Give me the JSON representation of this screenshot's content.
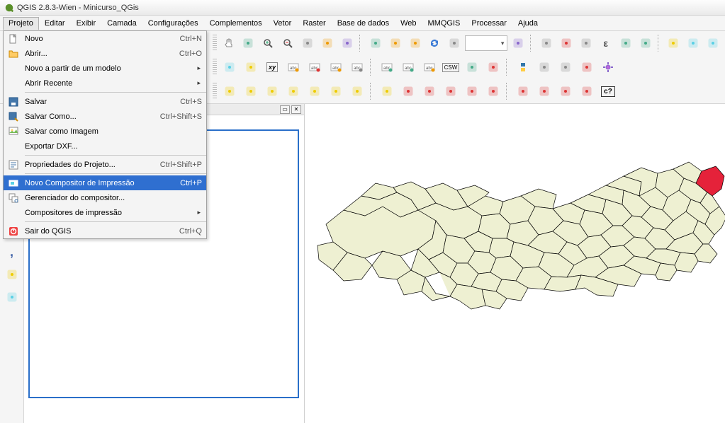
{
  "window": {
    "title": "QGIS 2.8.3-Wien - Minicurso_QGis"
  },
  "menubar": {
    "items": [
      "Projeto",
      "Editar",
      "Exibir",
      "Camada",
      "Configurações",
      "Complementos",
      "Vetor",
      "Raster",
      "Base de dados",
      "Web",
      "MMQGIS",
      "Processar",
      "Ajuda"
    ]
  },
  "dropdown": {
    "items": [
      {
        "icon": "new-file-icon",
        "label": "Novo",
        "shortcut": "Ctrl+N"
      },
      {
        "icon": "open-folder-icon",
        "label": "Abrir...",
        "shortcut": "Ctrl+O"
      },
      {
        "icon": "",
        "label": "Novo a partir de um modelo",
        "submenu": true
      },
      {
        "icon": "",
        "label": "Abrir Recente",
        "submenu": true
      },
      {
        "sep": true
      },
      {
        "icon": "save-icon",
        "label": "Salvar",
        "shortcut": "Ctrl+S"
      },
      {
        "icon": "save-as-icon",
        "label": "Salvar Como...",
        "shortcut": "Ctrl+Shift+S"
      },
      {
        "icon": "save-image-icon",
        "label": "Salvar como Imagem"
      },
      {
        "icon": "",
        "label": "Exportar DXF..."
      },
      {
        "sep": true
      },
      {
        "icon": "properties-icon",
        "label": "Propriedades do Projeto...",
        "shortcut": "Ctrl+Shift+P"
      },
      {
        "sep": true
      },
      {
        "icon": "print-composer-icon",
        "label": "Novo Compositor de Impressão",
        "shortcut": "Ctrl+P",
        "selected": true
      },
      {
        "icon": "composer-manager-icon",
        "label": "Gerenciador do compositor..."
      },
      {
        "icon": "",
        "label": "Compositores de impressão",
        "submenu": true
      },
      {
        "sep": true
      },
      {
        "icon": "exit-icon",
        "label": "Sair do QGIS",
        "shortcut": "Ctrl+Q"
      }
    ]
  },
  "toolbar": {
    "row1_icons": [
      "hand-icon",
      "pan-select-icon",
      "zoom-in-icon",
      "zoom-out-icon",
      "zoom-1-1-icon",
      "zoom-full-icon",
      "zoom-selection-icon",
      "zoom-layer-icon",
      "zoom-last-icon",
      "zoom-next-icon",
      "refresh-icon",
      "identify-icon",
      "select-icon",
      "deselect-icon",
      "measure-icon",
      "bookmark-icon",
      "epsilon-icon",
      "attr-table-icon",
      "field-calc-icon",
      "stats-icon",
      "tips-icon",
      "html-icon"
    ],
    "row2_icons": [
      "copy-icon",
      "paste-icon",
      "xy-icon",
      "abc-label-icon",
      "abc-pin-icon",
      "abc-layer-icon",
      "abc-move-icon",
      "abc-rotate-icon",
      "abc-change-icon",
      "abc-plain-icon",
      "csw-icon",
      "db-icon",
      "diamond-icon",
      "python-icon",
      "calendar-icon",
      "mountain-icon",
      "palette-icon",
      "gear-icon"
    ],
    "row3_icons": [
      "poly1-icon",
      "poly2-icon",
      "poly3-icon",
      "poly4-icon",
      "poly5-icon",
      "poly6-icon",
      "poly7-icon",
      "poly8-icon",
      "raster1-icon",
      "raster2-icon",
      "raster3-icon",
      "raster4-icon",
      "raster5-icon",
      "raster6-icon",
      "raster7-icon",
      "raster8-icon",
      "raster9-icon",
      "help-icon"
    ],
    "help_label": "c?"
  },
  "leftbar_icons": [
    "wave-icon",
    "dots-icon",
    "puzzle-icon",
    "globe-add-icon",
    "globe-grid-icon",
    "vector-node-icon",
    "comma-icon",
    "nodes-icon",
    "tree-icon"
  ],
  "colors": {
    "accent": "#2f6fd0",
    "map_fill": "#eef0d2",
    "map_stroke": "#000000",
    "highlight": "#e5223a"
  }
}
